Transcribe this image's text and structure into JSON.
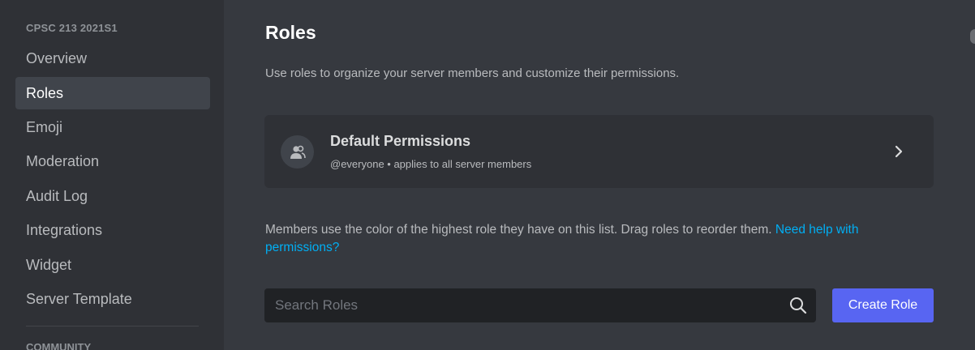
{
  "sidebar": {
    "header": "CPSC 213 2021S1",
    "items": [
      {
        "label": "Overview"
      },
      {
        "label": "Roles",
        "active": true
      },
      {
        "label": "Emoji"
      },
      {
        "label": "Moderation"
      },
      {
        "label": "Audit Log"
      },
      {
        "label": "Integrations"
      },
      {
        "label": "Widget"
      },
      {
        "label": "Server Template"
      }
    ],
    "footer_header": "COMMUNITY"
  },
  "main": {
    "title": "Roles",
    "description": "Use roles to organize your server members and customize their permissions.",
    "default_permissions": {
      "title": "Default Permissions",
      "subtitle": "@everyone • applies to all server members",
      "icon": "members-icon",
      "chevron_icon": "chevron-right-icon"
    },
    "info_text": "Members use the color of the highest role they have on this list. Drag roles to reorder them.",
    "help_link": "Need help with permissions?",
    "search": {
      "placeholder": "Search Roles",
      "value": "",
      "icon": "search-icon"
    },
    "create_role_label": "Create Role"
  },
  "colors": {
    "accent": "#5865f2",
    "link": "#00aff4",
    "background": "#36393f",
    "sidebar": "#2f3136"
  }
}
